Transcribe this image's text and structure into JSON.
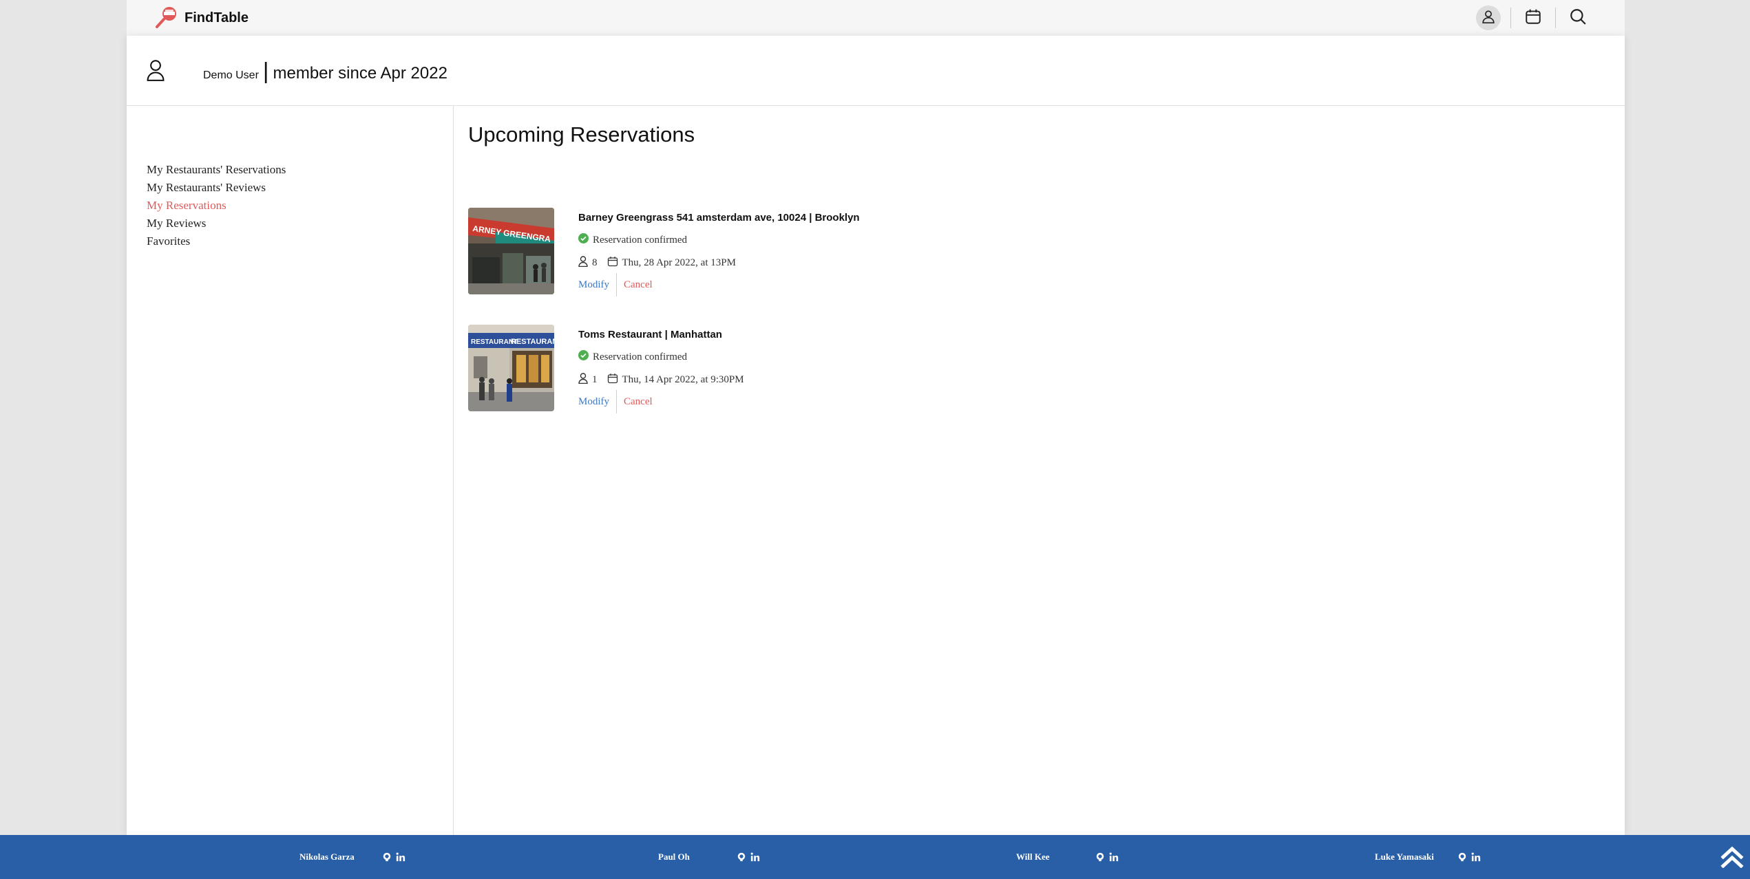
{
  "brand": {
    "name": "FindTable",
    "accent_color": "#e05a5a"
  },
  "nav": {
    "icons": [
      "user-icon",
      "calendar-icon",
      "search-icon"
    ],
    "active": "user-icon"
  },
  "profile": {
    "name": "Demo User",
    "divider": "|",
    "member_since": "member since Apr 2022"
  },
  "sidebar": {
    "items": [
      {
        "label": "My Restaurants' Reservations"
      },
      {
        "label": "My Restaurants' Reviews"
      },
      {
        "label": "My Reservations",
        "active": true
      },
      {
        "label": "My Reviews"
      },
      {
        "label": "Favorites"
      }
    ]
  },
  "main": {
    "title": "Upcoming Reservations",
    "reservations": [
      {
        "title": "Barney Greengrass 541 amsterdam ave, 10024 | Brooklyn",
        "status": "Reservation confirmed",
        "party_size": "8",
        "datetime": "Thu, 28 Apr 2022, at 13PM",
        "modify_label": "Modify",
        "cancel_label": "Cancel"
      },
      {
        "title": "Toms Restaurant | Manhattan",
        "status": "Reservation confirmed",
        "party_size": "1",
        "datetime": "Thu, 14 Apr 2022, at 9:30PM",
        "modify_label": "Modify",
        "cancel_label": "Cancel"
      }
    ]
  },
  "footer": {
    "background": "#285fa6",
    "credits": [
      {
        "name": "Nikolas Garza"
      },
      {
        "name": "Paul Oh"
      },
      {
        "name": "Will Kee"
      },
      {
        "name": "Luke Yamasaki"
      }
    ]
  },
  "colors": {
    "status_ok": "#4caf50",
    "link_blue": "#3d78c2",
    "cancel_red": "#e05a5a"
  }
}
